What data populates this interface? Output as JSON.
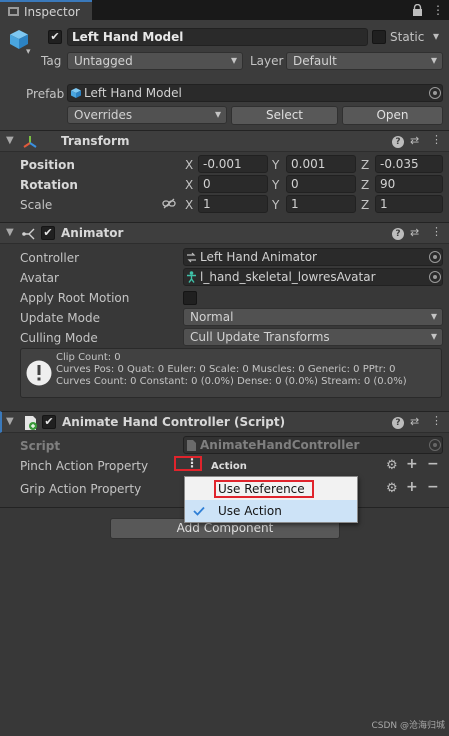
{
  "window": {
    "tab_label": "Inspector",
    "tab_icon": "inspector-icon",
    "lock_icon": "lock-icon",
    "menu_icon": "more-menu-icon",
    "menu_glyph": "⋮"
  },
  "gameobject": {
    "name": "Left Hand Model",
    "active_checked": true,
    "static_label": "Static",
    "static_checked": false,
    "tag_label": "Tag",
    "tag_value": "Untagged",
    "layer_label": "Layer",
    "layer_value": "Default",
    "prefab_label": "Prefab",
    "prefab_value": "Left Hand Model",
    "overrides_value": "Overrides",
    "select_label": "Select",
    "open_label": "Open"
  },
  "transform": {
    "title": "Transform",
    "position_label": "Position",
    "rotation_label": "Rotation",
    "scale_label": "Scale",
    "x": "X",
    "y": "Y",
    "z": "Z",
    "position": {
      "x": "-0.001",
      "y": "0.001",
      "z": "-0.035"
    },
    "rotation": {
      "x": "0",
      "y": "0",
      "z": "90"
    },
    "scale": {
      "x": "1",
      "y": "1",
      "z": "1"
    }
  },
  "animator": {
    "title": "Animator",
    "enabled": true,
    "controller_label": "Controller",
    "controller_value": "Left Hand Animator",
    "avatar_label": "Avatar",
    "avatar_value": "l_hand_skeletal_lowresAvatar",
    "apply_root_motion_label": "Apply Root Motion",
    "apply_root_motion": false,
    "update_mode_label": "Update Mode",
    "update_mode_value": "Normal",
    "culling_mode_label": "Culling Mode",
    "culling_mode_value": "Cull Update Transforms",
    "info_lines": [
      "Clip Count: 0",
      "Curves Pos: 0 Quat: 0 Euler: 0 Scale: 0 Muscles: 0 Generic: 0 PPtr: 0",
      "Curves Count: 0 Constant: 0 (0.0%) Dense: 0 (0.0%) Stream: 0 (0.0%)"
    ]
  },
  "script_component": {
    "title": "Animate Hand Controller (Script)",
    "enabled": true,
    "script_label": "Script",
    "script_value": "AnimateHandController",
    "pinch_label": "Pinch Action Property",
    "pinch_value": "Action",
    "grip_label": "Grip Action Property"
  },
  "add_component_label": "Add Component",
  "popup": {
    "items": [
      {
        "label": "Use Reference",
        "checked": false,
        "highlighted": true
      },
      {
        "label": "Use Action",
        "checked": true,
        "highlighted": false
      }
    ]
  },
  "watermark": "CSDN @沧海归城",
  "colors": {
    "accent": "#3a79bb",
    "highlight_red": "#e0242c",
    "checkmark_blue": "#2f7fd6"
  }
}
